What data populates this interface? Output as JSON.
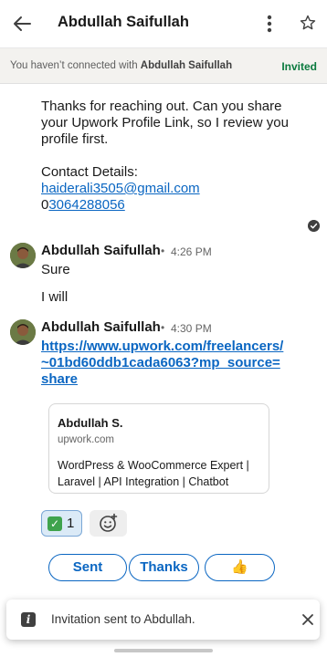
{
  "header": {
    "title": "Abdullah Saifullah",
    "back_icon": "arrow-left-icon",
    "more_icon": "more-vertical-icon",
    "star_icon": "star-outline-icon"
  },
  "banner": {
    "prefix": "You haven’t connected with ",
    "name": "Abdullah Saifullah",
    "status": "Invited",
    "status_color": "#0a7a3e"
  },
  "outgoing_message": {
    "line1": "Thanks for reaching out. Can you share",
    "line2": "your Upwork Profile Link, so I review you",
    "line3": "profile first.",
    "contact_label": "Contact Details:",
    "email": "haiderali3505@gmail.com",
    "phone_prefix": "0",
    "phone_link": "3064288056"
  },
  "messages": [
    {
      "sender": "Abdullah Saifullah",
      "separator": "•",
      "time": "4:26 PM",
      "lines": [
        "Sure",
        "I will"
      ]
    },
    {
      "sender": "Abdullah Saifullah",
      "separator": "•",
      "time": "4:30 PM",
      "link_lines": [
        "https://www.upwork.com/freelancers/",
        "~01bd60ddb1cada6063?mp_source=",
        "share"
      ]
    }
  ],
  "link_preview": {
    "title": "Abdullah S.",
    "domain": "upwork.com",
    "desc_line1": "WordPress & WooCommerce Expert |",
    "desc_line2": "Laravel | API Integration | Chatbot"
  },
  "reactions": {
    "emoji_icon": "check-mark-button-icon",
    "count": "1",
    "add_icon": "add-reaction-icon"
  },
  "quick_replies": [
    "Sent",
    "Thanks",
    "👍"
  ],
  "toast": {
    "text": "Invitation sent to Abdullah.",
    "icon": "info-icon",
    "close_icon": "close-icon"
  },
  "colors": {
    "accent": "#0a66c2",
    "text": "#191919"
  }
}
